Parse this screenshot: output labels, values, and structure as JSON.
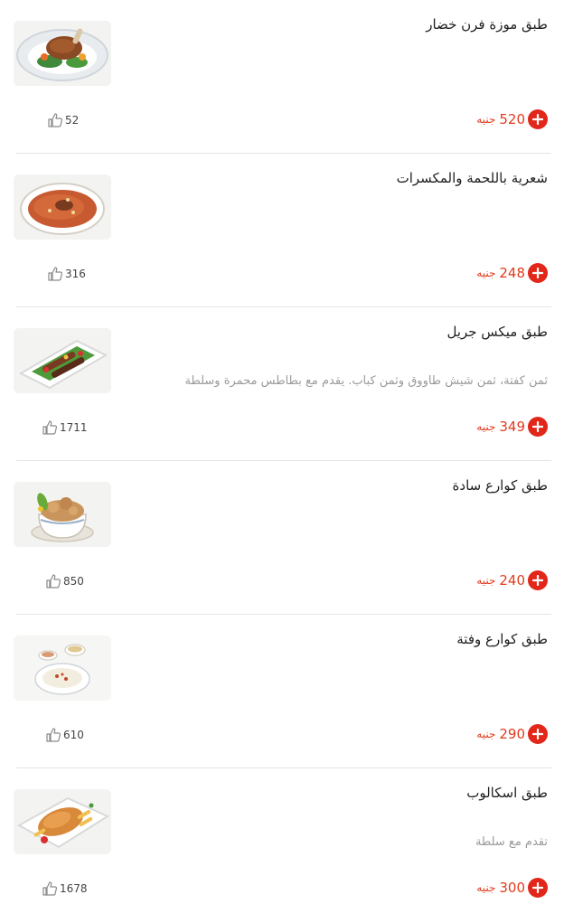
{
  "currency_label": "جنيه",
  "items": [
    {
      "title": "طبق موزة فرن خضار",
      "description": "",
      "price": "520",
      "likes": "52",
      "image_icon": "roast-lamb-plate-photo"
    },
    {
      "title": "شعرية باللحمة والمكسرات",
      "description": "",
      "price": "248",
      "likes": "316",
      "image_icon": "noodles-meat-plate-photo"
    },
    {
      "title": "طبق ميكس جريل",
      "description": "ثمن كفتة، ثمن شيش طاووق وثمن كباب. يقدم مع بطاطس محمرة وسلطة",
      "price": "349",
      "likes": "1711",
      "image_icon": "mixed-grill-plate-photo"
    },
    {
      "title": "طبق كوارع سادة",
      "description": "",
      "price": "240",
      "likes": "850",
      "image_icon": "trotters-bowl-photo"
    },
    {
      "title": "طبق كوارع وفتة",
      "description": "",
      "price": "290",
      "likes": "610",
      "image_icon": "trotters-fatta-photo"
    },
    {
      "title": "طبق اسكالوب",
      "description": "تقدم مع سلطة",
      "price": "300",
      "likes": "1678",
      "image_icon": "escalope-plate-photo"
    }
  ],
  "colors": {
    "accent": "#e2261a",
    "price": "#e23b1e",
    "description": "#9a9a9a"
  }
}
